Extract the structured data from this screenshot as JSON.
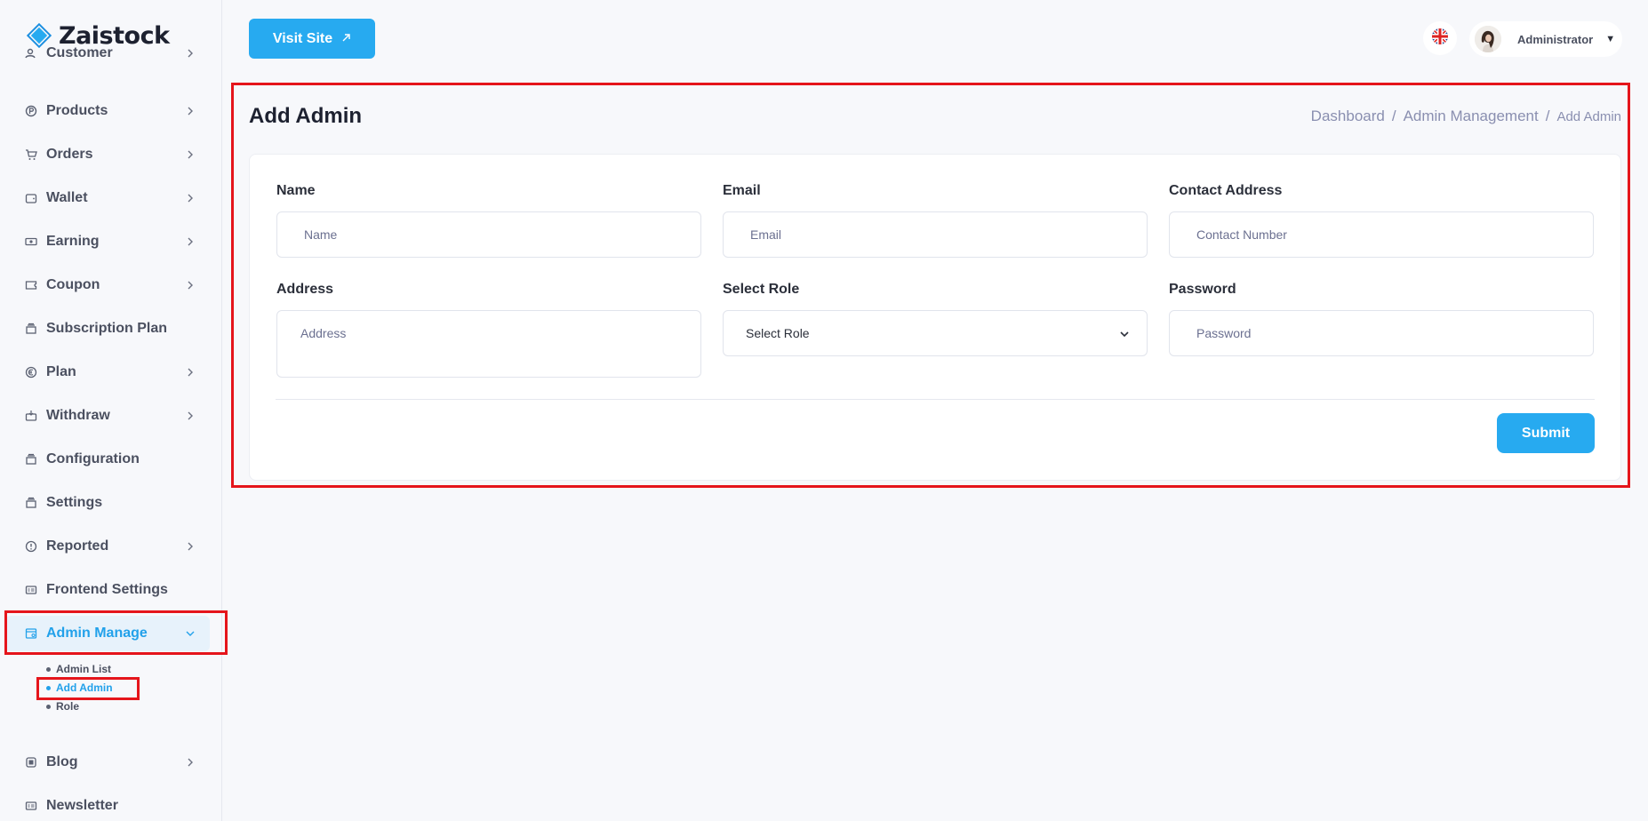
{
  "app": {
    "logo_text": "Zaistock",
    "brand_color": "#27aaf0",
    "highlight_color": "#e5151b"
  },
  "sidebar": {
    "items": [
      {
        "label": "Customer",
        "icon": "customer-icon",
        "has_chevron": true
      },
      {
        "label": "Products",
        "icon": "products-icon",
        "has_chevron": true
      },
      {
        "label": "Orders",
        "icon": "cart-icon",
        "has_chevron": true
      },
      {
        "label": "Wallet",
        "icon": "wallet-icon",
        "has_chevron": true
      },
      {
        "label": "Earning",
        "icon": "earning-icon",
        "has_chevron": true
      },
      {
        "label": "Coupon",
        "icon": "coupon-icon",
        "has_chevron": true
      },
      {
        "label": "Subscription Plan",
        "icon": "subscription-icon",
        "has_chevron": false
      },
      {
        "label": "Plan",
        "icon": "plan-icon",
        "has_chevron": true
      },
      {
        "label": "Withdraw",
        "icon": "withdraw-icon",
        "has_chevron": true
      },
      {
        "label": "Configuration",
        "icon": "configuration-icon",
        "has_chevron": false
      },
      {
        "label": "Settings",
        "icon": "settings-icon",
        "has_chevron": false
      },
      {
        "label": "Reported",
        "icon": "reported-icon",
        "has_chevron": true
      },
      {
        "label": "Frontend Settings",
        "icon": "frontend-settings-icon",
        "has_chevron": false
      },
      {
        "label": "Admin Manage",
        "icon": "admin-manage-icon",
        "has_chevron": true,
        "expanded": true
      },
      {
        "label": "Blog",
        "icon": "blog-icon",
        "has_chevron": true
      },
      {
        "label": "Newsletter",
        "icon": "newsletter-icon",
        "has_chevron": false
      }
    ],
    "admin_submenu": [
      {
        "label": "Admin List"
      },
      {
        "label": "Add Admin",
        "active": true
      },
      {
        "label": "Role"
      }
    ]
  },
  "topbar": {
    "visit_site_label": "Visit Site",
    "language_icon": "uk-flag-icon",
    "user_name": "Administrator",
    "caret": "▼"
  },
  "page": {
    "title": "Add Admin",
    "breadcrumb": [
      "Dashboard",
      "Admin Management",
      "Add Admin"
    ],
    "breadcrumb_sep": "/"
  },
  "form": {
    "name": {
      "label": "Name",
      "placeholder": "Name",
      "value": ""
    },
    "email": {
      "label": "Email",
      "placeholder": "Email",
      "value": ""
    },
    "contact": {
      "label": "Contact Address",
      "placeholder": "Contact Number",
      "value": ""
    },
    "address": {
      "label": "Address",
      "placeholder": "Address",
      "value": ""
    },
    "role": {
      "label": "Select Role",
      "selected": "Select Role"
    },
    "password": {
      "label": "Password",
      "placeholder": "Password",
      "value": ""
    },
    "submit_label": "Submit"
  }
}
